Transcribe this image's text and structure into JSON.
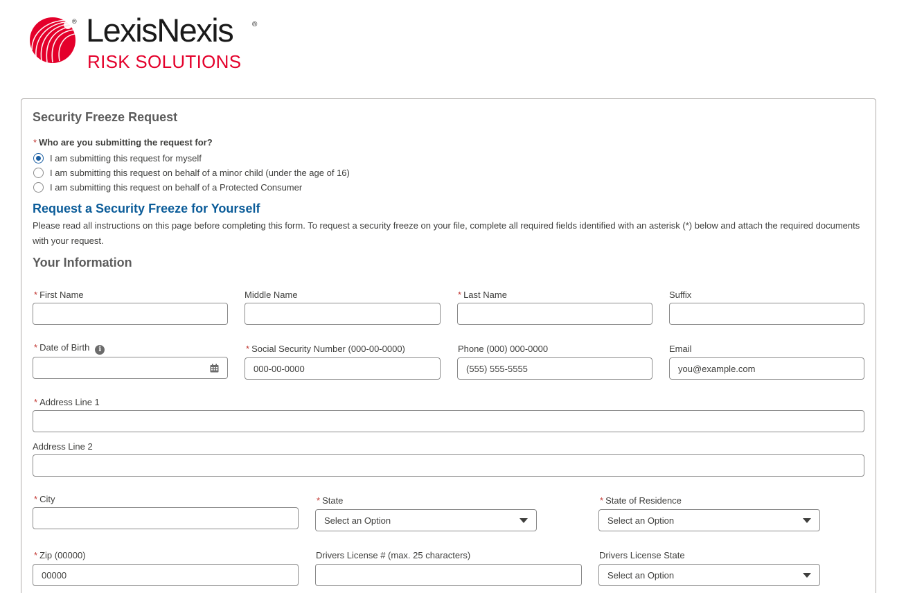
{
  "logo": {
    "name": "LexisNexis",
    "registered": "®",
    "subtitle": "RISK SOLUTIONS",
    "brand_color": "#e4002b"
  },
  "form": {
    "title": "Security Freeze Request",
    "question": {
      "required_mark": "*",
      "label": "Who are you submitting the request for?",
      "options": [
        {
          "label": "I am submitting this request for myself",
          "selected": true
        },
        {
          "label": "I am submitting this request on behalf of a minor child (under the age of 16)",
          "selected": false
        },
        {
          "label": "I am submitting this request on behalf of a Protected Consumer",
          "selected": false
        }
      ]
    },
    "subtitle": "Request a Security Freeze for Yourself",
    "instructions": "Please read all instructions on this page before completing this form. To request a security freeze on your file, complete all required fields identified with an asterisk (*) below and attach the required documents with your request.",
    "section": "Your Information",
    "fields": {
      "first_name": {
        "label": "First Name",
        "required": "*",
        "value": ""
      },
      "middle_name": {
        "label": "Middle Name",
        "value": ""
      },
      "last_name": {
        "label": "Last Name",
        "required": "*",
        "value": ""
      },
      "suffix": {
        "label": "Suffix",
        "value": ""
      },
      "dob": {
        "label": "Date of Birth",
        "required": "*",
        "value": ""
      },
      "ssn": {
        "label": "Social Security Number (000-00-0000)",
        "required": "*",
        "placeholder": "000-00-0000"
      },
      "phone": {
        "label": "Phone (000) 000-0000",
        "placeholder": "(555) 555-5555"
      },
      "email": {
        "label": "Email",
        "placeholder": "you@example.com"
      },
      "address1": {
        "label": "Address Line 1",
        "required": "*",
        "value": ""
      },
      "address2": {
        "label": "Address Line 2",
        "value": ""
      },
      "city": {
        "label": "City",
        "required": "*",
        "value": ""
      },
      "state": {
        "label": "State",
        "required": "*",
        "selected": "Select an Option"
      },
      "state_residence": {
        "label": "State of Residence",
        "required": "*",
        "selected": "Select an Option"
      },
      "zip": {
        "label": "Zip (00000)",
        "required": "*",
        "placeholder": "00000"
      },
      "dl_number": {
        "label": "Drivers License # (max. 25 characters)",
        "value": ""
      },
      "dl_state": {
        "label": "Drivers License State",
        "selected": "Select an Option"
      }
    }
  }
}
